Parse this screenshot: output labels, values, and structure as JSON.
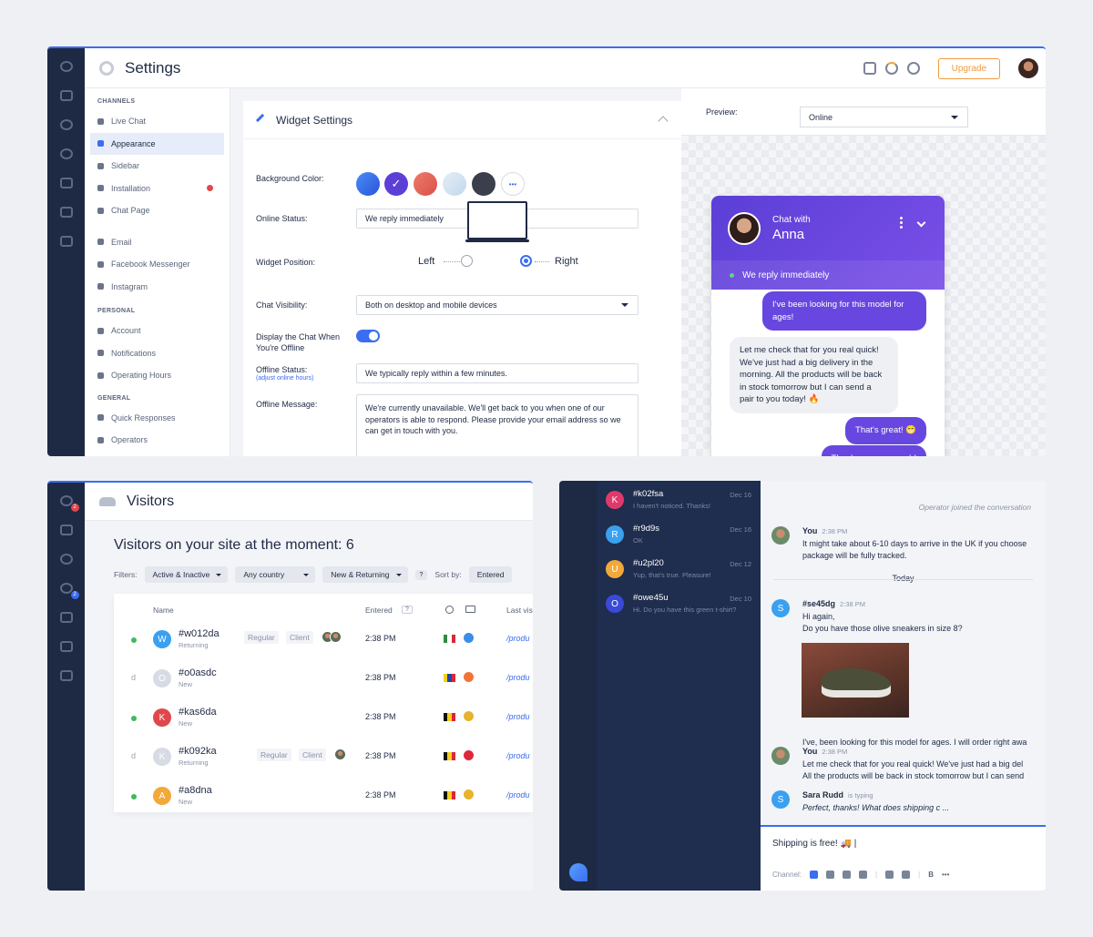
{
  "settings": {
    "title": "Settings",
    "upgrade_label": "Upgrade",
    "nav": {
      "channels_heading": "CHANNELS",
      "channels": [
        {
          "label": "Live Chat"
        },
        {
          "label": "Appearance",
          "active": true
        },
        {
          "label": "Sidebar"
        },
        {
          "label": "Installation",
          "alert": true
        },
        {
          "label": "Chat Page"
        },
        {
          "label": "Email"
        },
        {
          "label": "Facebook Messenger"
        },
        {
          "label": "Instagram"
        }
      ],
      "personal_heading": "PERSONAL",
      "personal": [
        {
          "label": "Account"
        },
        {
          "label": "Notifications"
        },
        {
          "label": "Operating Hours"
        }
      ],
      "general_heading": "GENERAL",
      "general": [
        {
          "label": "Quick Responses"
        },
        {
          "label": "Operators"
        }
      ]
    },
    "widget": {
      "header": "Widget Settings",
      "background_color_label": "Background Color:",
      "swatches": [
        "#3a6df0",
        "#5b3fd6",
        "#e8645a",
        "#cfe0ee",
        "#3a3f4b"
      ],
      "selected_swatch_index": 1,
      "more_label": "•••",
      "online_status_label": "Online Status:",
      "online_status_value": "We reply immediately",
      "widget_position_label": "Widget Position:",
      "position_left": "Left",
      "position_right": "Right",
      "position_selected": "Right",
      "chat_visibility_label": "Chat Visibility:",
      "chat_visibility_value": "Both on desktop and mobile devices",
      "display_offline_label": "Display the Chat When You're Offline",
      "display_offline_on": true,
      "offline_status_label": "Offline Status:",
      "offline_status_sub": "(adjust online hours)",
      "offline_status_value": "We typically reply within a few minutes.",
      "offline_message_label": "Offline Message:",
      "offline_message_value": "We're currently unavailable. We'll get back to you when one of our operators is able to respond. Please provide your email address so we can get in touch with you."
    },
    "preview": {
      "label": "Preview:",
      "select_value": "Online",
      "chat_with": "Chat with",
      "agent_name": "Anna",
      "status": "We reply immediately",
      "messages": [
        {
          "from": "visitor",
          "text": "I've been looking for this model for ages!"
        },
        {
          "from": "agent",
          "text": "Let me check that for you real quick! We've just had a big delivery in the morning. All the products will be back in stock tomorrow but I can send a pair to you today! 🔥"
        },
        {
          "from": "visitor",
          "text": "That's great! 😁"
        },
        {
          "from": "visitor",
          "text": "Thank you very much!"
        }
      ]
    }
  },
  "visitors": {
    "title": "Visitors",
    "heading": "Visitors on your site at the moment: 6",
    "filters_label": "Filters:",
    "filter_activity": "Active & Inactive",
    "filter_country": "Any country",
    "filter_type": "New & Returning",
    "help_label": "?",
    "sort_label": "Sort by:",
    "sort_value": "Entered",
    "columns": {
      "name": "Name",
      "entered": "Entered",
      "last_visited": "Last vis"
    },
    "rows": [
      {
        "id": "#w012da",
        "status": "Returning",
        "initial": "W",
        "color": "#3aa0f0",
        "online": true,
        "tags": [
          "Regular",
          "Client"
        ],
        "avatars": 2,
        "time": "2:38 PM",
        "flag": [
          "#2e8b3d",
          "#ffffff",
          "#d8283a"
        ],
        "browser": "#3a8ee8",
        "page": "/produ"
      },
      {
        "id": "#o0asdc",
        "status": "New",
        "initial": "O",
        "color": "#d7dbe3",
        "online": false,
        "tags": [],
        "avatars": 0,
        "time": "2:38 PM",
        "flag": [
          "#f5d020",
          "#2446a8",
          "#d8283a"
        ],
        "browser": "#f0743a",
        "page": "/produ"
      },
      {
        "id": "#kas6da",
        "status": "New",
        "initial": "K",
        "color": "#e0474c",
        "online": true,
        "tags": [],
        "avatars": 0,
        "time": "2:38 PM",
        "flag": [
          "#111111",
          "#f5d020",
          "#d8283a"
        ],
        "browser": "#e8b32a",
        "page": "/produ"
      },
      {
        "id": "#k092ka",
        "status": "Returning",
        "initial": "K",
        "color": "#d7dbe3",
        "online": false,
        "tags": [
          "Regular",
          "Client"
        ],
        "avatars": 1,
        "time": "2:38 PM",
        "flag": [
          "#111111",
          "#f5d020",
          "#d8283a"
        ],
        "browser": "#e0283a",
        "page": "/produ"
      },
      {
        "id": "#a8dna",
        "status": "New",
        "initial": "A",
        "color": "#f3a93a",
        "online": true,
        "tags": [],
        "avatars": 0,
        "time": "2:38 PM",
        "flag": [
          "#111111",
          "#f5d020",
          "#d8283a"
        ],
        "browser": "#e8b32a",
        "page": "/produ"
      }
    ]
  },
  "inbox": {
    "conversations": [
      {
        "id": "#k02fsa",
        "initial": "K",
        "color": "#e03a6a",
        "preview": "I haven't noticed. Thanks!",
        "date": "Dec 16"
      },
      {
        "id": "#r9d9s",
        "initial": "R",
        "color": "#3aa0f0",
        "preview": "OK",
        "date": "Dec 16"
      },
      {
        "id": "#u2pl20",
        "initial": "U",
        "color": "#f3a93a",
        "preview": "Yup, that's true. Pleasure!",
        "date": "Dec 12"
      },
      {
        "id": "#owe45u",
        "initial": "O",
        "color": "#3a4ad8",
        "preview": "Hi. Do you have this green t-shirt?",
        "date": "Dec 10"
      }
    ],
    "system_message": "Operator joined the conversation",
    "today_label": "Today",
    "messages": [
      {
        "sender": "You",
        "time": "2:38 PM",
        "lines": [
          "It might take about 6-10 days to arrive in the UK if you choose",
          "package will be fully tracked."
        ]
      },
      {
        "sender": "#se45dg",
        "time": "2:38 PM",
        "lines": [
          "Hi again,",
          "Do you have those olive sneakers in size 8?"
        ],
        "after_image": "I've, been looking for this model for ages. I will order right awa"
      },
      {
        "sender": "You",
        "time": "2:38 PM",
        "lines": [
          "Let me check that for you real quick! We've just had a big del",
          "All the products will be back in stock tomorrow but I can send"
        ]
      },
      {
        "sender": "Sara Rudd",
        "time": "is typing",
        "lines": [
          "Perfect, thanks! What does shipping c ..."
        ]
      }
    ],
    "composer_text": "Shipping is free! 🚚 |",
    "channel_label": "Channel:",
    "bold_label": "B",
    "more_label": "•••"
  },
  "badges": {
    "chat": "2",
    "visitors": "2"
  }
}
